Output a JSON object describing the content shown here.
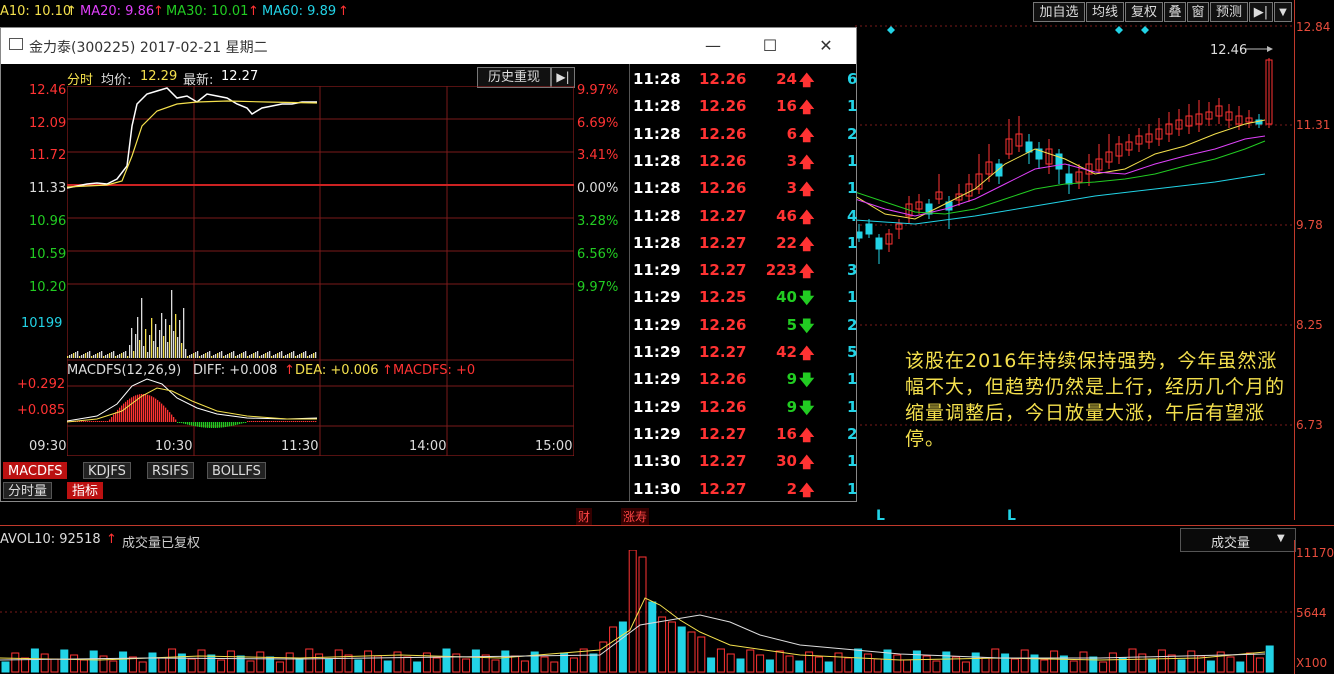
{
  "topbar": {
    "ma10": "A10: 10.10",
    "ma20": "MA20: 9.86",
    "ma30": "MA30: 10.01",
    "ma60": "MA60: 9.89",
    "buttons": [
      "加自选",
      "均线",
      "复权",
      "叠",
      "窗",
      "预测"
    ],
    "arrow_right": "▶|",
    "dropdown": "▼"
  },
  "right_axis": {
    "labels": [
      "12.84",
      "11.31",
      "9.78",
      "8.25",
      "6.73"
    ],
    "high_mark": "12.46"
  },
  "window": {
    "title": "金力泰(300225) 2017-02-21 星期二",
    "minimize": "—",
    "maximize": "☐",
    "close": "✕",
    "header": {
      "fenshi": "分时",
      "avg_label": "均价:",
      "avg_value": "12.29",
      "latest_label": "最新:",
      "latest_value": "12.27"
    },
    "history_btn": "历史重现",
    "history_arrow": "▶|",
    "price_labels": [
      "12.46",
      "12.09",
      "11.72",
      "11.33",
      "10.96",
      "10.59",
      "10.20"
    ],
    "pct_labels": [
      "9.97%",
      "6.69%",
      "3.41%",
      "0.00%",
      "3.28%",
      "6.56%",
      "9.97%"
    ],
    "vol_label": "10199",
    "macd_header": {
      "name": "MACDFS(12,26,9)",
      "diff": "DIFF: +0.008",
      "dea": "DEA: +0.006",
      "macdfs": "MACDFS: +0"
    },
    "macd_labels": [
      "+0.292",
      "+0.085"
    ],
    "time_labels": [
      "09:30",
      "10:30",
      "11:30",
      "14:00",
      "15:00"
    ],
    "tabs": [
      "MACDFS",
      "KDJFS",
      "RSIFS",
      "BOLLFS"
    ],
    "subtabs": [
      "分时量",
      "指标"
    ],
    "ticks": [
      {
        "time": "11:28",
        "price": "12.26",
        "vol": "24",
        "dir": "up",
        "n": "6"
      },
      {
        "time": "11:28",
        "price": "12.26",
        "vol": "16",
        "dir": "up",
        "n": "1"
      },
      {
        "time": "11:28",
        "price": "12.26",
        "vol": "6",
        "dir": "up",
        "n": "2"
      },
      {
        "time": "11:28",
        "price": "12.26",
        "vol": "3",
        "dir": "up",
        "n": "1"
      },
      {
        "time": "11:28",
        "price": "12.26",
        "vol": "3",
        "dir": "up",
        "n": "1"
      },
      {
        "time": "11:28",
        "price": "12.27",
        "vol": "46",
        "dir": "up",
        "n": "4"
      },
      {
        "time": "11:28",
        "price": "12.27",
        "vol": "22",
        "dir": "up",
        "n": "1"
      },
      {
        "time": "11:29",
        "price": "12.27",
        "vol": "223",
        "dir": "up",
        "n": "3"
      },
      {
        "time": "11:29",
        "price": "12.25",
        "vol": "40",
        "dir": "down",
        "n": "1"
      },
      {
        "time": "11:29",
        "price": "12.26",
        "vol": "5",
        "dir": "down",
        "n": "2"
      },
      {
        "time": "11:29",
        "price": "12.27",
        "vol": "42",
        "dir": "up",
        "n": "5"
      },
      {
        "time": "11:29",
        "price": "12.26",
        "vol": "9",
        "dir": "down",
        "n": "1"
      },
      {
        "time": "11:29",
        "price": "12.26",
        "vol": "9",
        "dir": "down",
        "n": "1"
      },
      {
        "time": "11:29",
        "price": "12.27",
        "vol": "16",
        "dir": "up",
        "n": "2"
      },
      {
        "time": "11:30",
        "price": "12.27",
        "vol": "30",
        "dir": "up",
        "n": "1"
      },
      {
        "time": "11:30",
        "price": "12.27",
        "vol": "2",
        "dir": "up",
        "n": "1"
      }
    ]
  },
  "markers": {
    "cai": "财",
    "zhang": "涨寿",
    "L1": "L",
    "L2": "L"
  },
  "annotation": "该股在2016年持续保持强势，今年虽然涨幅不大，但趋势仍然是上行，经历几个月的缩量调整后，今日放量大涨，午后有望涨停。",
  "volume_panel": {
    "avol": "AVOL10: 92518",
    "note": "成交量已复权",
    "selector": "成交量",
    "selector_arrow": "▼",
    "labels": [
      "11170",
      "5644",
      "X100"
    ]
  },
  "colors": {
    "up": "#ff3333",
    "down": "#22cc22",
    "cyan": "#22d3e6",
    "yellow": "#f4e04d",
    "axis_red": "#c0392b"
  }
}
